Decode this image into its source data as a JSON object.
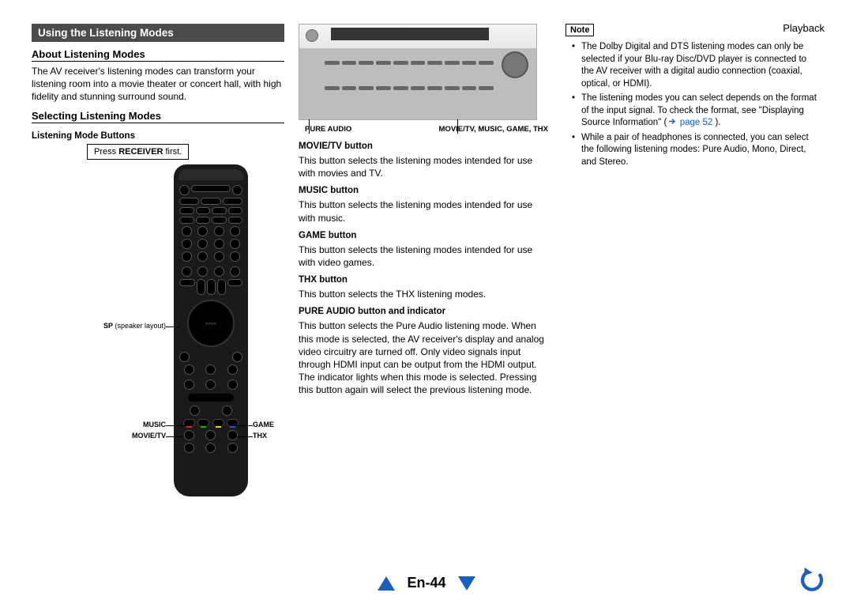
{
  "header": {
    "section": "Playback"
  },
  "title_bar": "Using the Listening Modes",
  "about": {
    "heading": "About Listening Modes",
    "body": "The AV receiver's listening modes can transform your listening room into a movie theater or concert hall, with high fidelity and stunning surround sound."
  },
  "selecting": {
    "heading": "Selecting Listening Modes",
    "sub": "Listening Mode Buttons",
    "press_prefix": "Press ",
    "press_bold": "RECEIVER",
    "press_suffix": " first.",
    "callout_sp": "SP",
    "callout_sp_paren": " (speaker layout)",
    "callout_music": "MUSIC",
    "callout_movietv": "MOVIE/TV",
    "callout_game": "GAME",
    "callout_thx": "THX"
  },
  "receiver_labels": {
    "left": "PURE AUDIO",
    "right": "MOVIE/TV, MUSIC, GAME, THX"
  },
  "buttons": {
    "movietv": {
      "h": "MOVIE/TV button",
      "p": "This button selects the listening modes intended for use with movies and TV."
    },
    "music": {
      "h": "MUSIC button",
      "p": "This button selects the listening modes intended for use with music."
    },
    "game": {
      "h": "GAME button",
      "p": "This button selects the listening modes intended for use with video games."
    },
    "thx": {
      "h": "THX button",
      "p": "This button selects the THX listening modes."
    },
    "pure": {
      "h": "PURE AUDIO button and indicator",
      "p": "This button selects the Pure Audio listening mode. When this mode is selected, the AV receiver's display and analog video circuitry are turned off. Only video signals input through HDMI input can be output from the HDMI output. The indicator lights when this mode is selected. Pressing this button again will select the previous listening mode."
    }
  },
  "note": {
    "label": "Note",
    "items": [
      "The Dolby Digital and DTS listening modes can only be selected if your Blu-ray Disc/DVD player is connected to the AV receiver with a digital audio connection (coaxial, optical, or HDMI).",
      "The listening modes you can select depends on the format of the input signal. To check the format, see \"Displaying Source Information\" (",
      "While a pair of headphones is connected, you can select the following listening modes: Pure Audio, Mono, Direct, and Stereo."
    ],
    "page_ref": "page 52",
    "item2_tail": ")."
  },
  "footer": {
    "page": "En-44"
  }
}
